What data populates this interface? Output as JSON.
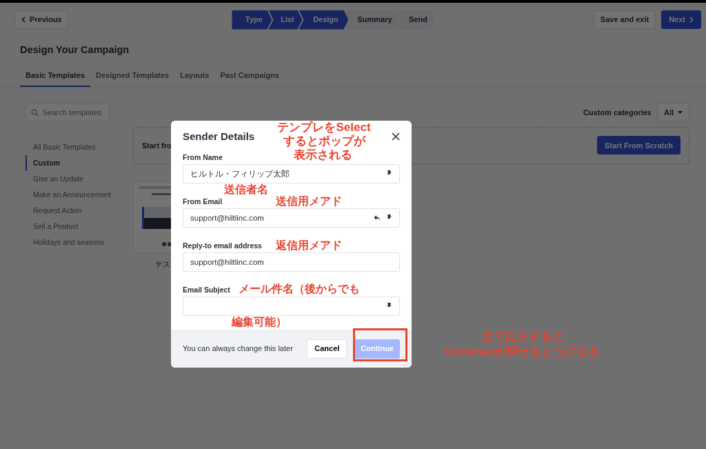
{
  "header": {
    "previous": "Previous",
    "steps": [
      {
        "label": "Type",
        "completed": true
      },
      {
        "label": "List",
        "completed": true
      },
      {
        "label": "Design",
        "completed": true
      },
      {
        "label": "Summary",
        "completed": false
      },
      {
        "label": "Send",
        "completed": false
      }
    ],
    "save": "Save and exit",
    "next": "Next"
  },
  "page_title": "Design Your Campaign",
  "tabs": [
    {
      "label": "Basic Templates",
      "selected": true
    },
    {
      "label": "Designed Templates",
      "selected": false
    },
    {
      "label": "Layouts",
      "selected": false
    },
    {
      "label": "Past Campaigns",
      "selected": false
    }
  ],
  "search": {
    "placeholder": "Search templates"
  },
  "categories": {
    "label": "Custom categories",
    "value": "All"
  },
  "sidebar": {
    "items": [
      {
        "label": "All Basic Templates",
        "selected": false
      },
      {
        "label": "Custom",
        "selected": true
      },
      {
        "label": "Give an Update",
        "selected": false
      },
      {
        "label": "Make an Announcement",
        "selected": false
      },
      {
        "label": "Request Action",
        "selected": false
      },
      {
        "label": "Sell a Product",
        "selected": false
      },
      {
        "label": "Holidays and seasons",
        "selected": false
      }
    ]
  },
  "scratch": {
    "text": "Start fro",
    "button": "Start From Scratch"
  },
  "templates": [
    {
      "kind": "picture",
      "caption": "テス"
    }
  ],
  "dialog": {
    "title": "Sender Details",
    "fields": [
      {
        "label": "From Name",
        "value": "ヒルトル・フィリップ太郎",
        "reply_icon": false,
        "merge_icon": true
      },
      {
        "label": "From Email",
        "value": "support@hiltlinc.com",
        "reply_icon": true,
        "merge_icon": true
      },
      {
        "label": "Reply-to email address",
        "value": "support@hiltlinc.com",
        "reply_icon": false,
        "merge_icon": false
      },
      {
        "label": "Email Subject",
        "reply_icon": false,
        "merge_icon": true
      }
    ],
    "footer_note": "You can always change this later",
    "cancel": "Cancel",
    "continue": {
      "label": "Continue",
      "disabled": true
    }
  },
  "annotations": [
    {
      "kind": "note",
      "text": "テンプレをSelect"
    },
    {
      "kind": "note",
      "text": "するとポップが"
    },
    {
      "kind": "note",
      "text": "表示される"
    },
    {
      "kind": "note",
      "text": "送信者名"
    },
    {
      "kind": "note",
      "text": "送信用メアド"
    },
    {
      "kind": "note",
      "text": "返信用メアド"
    },
    {
      "kind": "note",
      "text": "メール件名（後からでも"
    },
    {
      "kind": "note",
      "text": "編集可能）"
    },
    {
      "kind": "highlight"
    },
    {
      "kind": "note",
      "text": "全て記入すると"
    },
    {
      "kind": "note",
      "text": "Continueが押せるようになる"
    }
  ]
}
